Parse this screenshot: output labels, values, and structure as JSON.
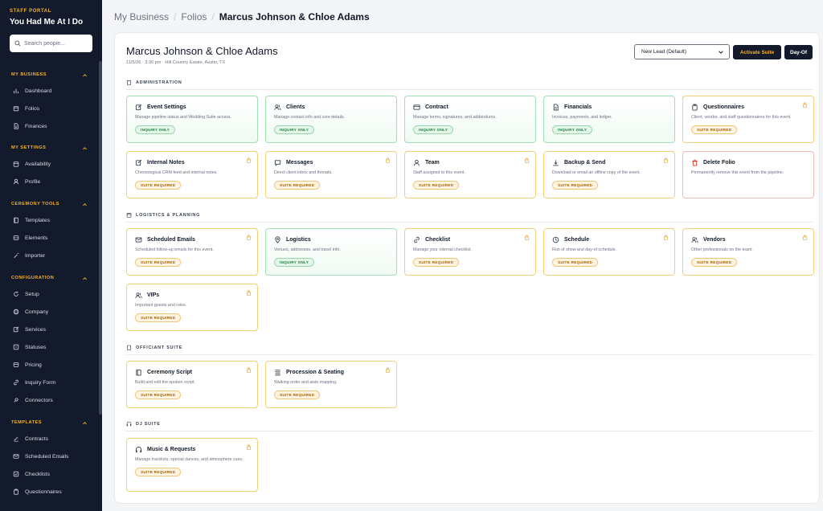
{
  "sidebar": {
    "kicker": "STAFF PORTAL",
    "title": "You Had Me At I Do",
    "search_placeholder": "Search people...",
    "sections": [
      {
        "label": "MY BUSINESS",
        "items": [
          {
            "label": "Dashboard",
            "icon": "bar-chart-icon"
          },
          {
            "label": "Folios",
            "icon": "folder-icon"
          },
          {
            "label": "Finances",
            "icon": "document-icon"
          }
        ]
      },
      {
        "label": "MY SETTINGS",
        "items": [
          {
            "label": "Availability",
            "icon": "calendar-icon"
          },
          {
            "label": "Profile",
            "icon": "user-icon"
          }
        ]
      },
      {
        "label": "CEREMONY TOOLS",
        "items": [
          {
            "label": "Templates",
            "icon": "book-icon"
          },
          {
            "label": "Elements",
            "icon": "layers-icon"
          },
          {
            "label": "Importer",
            "icon": "wand-icon"
          }
        ]
      },
      {
        "label": "CONFIGURATION",
        "items": [
          {
            "label": "Setup",
            "icon": "refresh-icon"
          },
          {
            "label": "Company",
            "icon": "globe-icon"
          },
          {
            "label": "Services",
            "icon": "edit-icon"
          },
          {
            "label": "Statuses",
            "icon": "list-icon"
          },
          {
            "label": "Pricing",
            "icon": "tag-icon"
          },
          {
            "label": "Inquiry Form",
            "icon": "link-icon"
          },
          {
            "label": "Connectors",
            "icon": "plug-icon"
          }
        ]
      },
      {
        "label": "TEMPLATES",
        "items": [
          {
            "label": "Contracts",
            "icon": "pen-icon"
          },
          {
            "label": "Scheduled Emails",
            "icon": "mail-icon"
          },
          {
            "label": "Checklists",
            "icon": "check-square-icon"
          },
          {
            "label": "Questionnaires",
            "icon": "clipboard-icon"
          }
        ]
      }
    ]
  },
  "breadcrumb": {
    "items": [
      "My Business",
      "Folios"
    ],
    "current": "Marcus Johnson & Chloe Adams"
  },
  "folio": {
    "title": "Marcus Johnson & Chloe Adams",
    "subtitle": "11/5/26 · 3:30 pm · Hill Country Estate, Austin, TX",
    "status_selected": "New Lead (Default)",
    "activate_label": "Activate Suite",
    "dayof_label": "Day-Of"
  },
  "badges": {
    "suite": "SUITE REQUIRED",
    "inquiry": "INQUIRY ONLY"
  },
  "colors": {
    "sidebar_bg": "#131a2b",
    "accent": "#f2b233",
    "inquiry_green": "#1b7a3e",
    "suite_amber": "#a35d00",
    "danger": "#d92d20"
  },
  "sections": {
    "administration": {
      "label": "ADMINISTRATION",
      "cards": [
        {
          "title": "Event Settings",
          "desc": "Manage pipeline status and Wedding Suite access.",
          "badge": "inquiry",
          "lock": false,
          "icon": "edit-icon"
        },
        {
          "title": "Clients",
          "desc": "Manage contact info and core details.",
          "badge": "inquiry",
          "lock": false,
          "icon": "users-icon"
        },
        {
          "title": "Contract",
          "desc": "Manage terms, signatures, and addendums.",
          "badge": "inquiry",
          "lock": false,
          "icon": "contract-icon"
        },
        {
          "title": "Financials",
          "desc": "Invoices, payments, and ledger.",
          "badge": "inquiry",
          "lock": false,
          "icon": "document-icon"
        },
        {
          "title": "Questionnaires",
          "desc": "Client, vendor, and staff questionnaires for this event.",
          "badge": "suite",
          "lock": true,
          "icon": "clipboard-icon"
        },
        {
          "title": "Internal Notes",
          "desc": "Chronological CRM feed and internal notes.",
          "badge": "suite",
          "lock": true,
          "icon": "edit-icon"
        },
        {
          "title": "Messages",
          "desc": "Direct client inbox and threads.",
          "badge": "suite",
          "lock": true,
          "icon": "message-icon"
        },
        {
          "title": "Team",
          "desc": "Staff assigned to this event.",
          "badge": "suite",
          "lock": true,
          "icon": "user-icon"
        },
        {
          "title": "Backup & Send",
          "desc": "Download or email an offline copy of the event.",
          "badge": "suite",
          "lock": true,
          "icon": "download-icon"
        },
        {
          "title": "Delete Folio",
          "desc": "Permanently remove this event from the pipeline.",
          "badge": "none",
          "lock": false,
          "icon": "trash-icon"
        }
      ]
    },
    "logistics": {
      "label": "LOGISTICS & PLANNING",
      "cards": [
        {
          "title": "Scheduled Emails",
          "desc": "Scheduled follow-up emails for this event.",
          "badge": "suite",
          "lock": true,
          "icon": "mail-icon"
        },
        {
          "title": "Logistics",
          "desc": "Venues, addresses, and travel info.",
          "badge": "inquiry",
          "lock": false,
          "icon": "map-pin-icon"
        },
        {
          "title": "Checklist",
          "desc": "Manage your internal checklist.",
          "badge": "suite",
          "lock": true,
          "icon": "link-icon"
        },
        {
          "title": "Schedule",
          "desc": "Run of show and day-of schedule.",
          "badge": "suite",
          "lock": true,
          "icon": "clock-icon"
        },
        {
          "title": "Vendors",
          "desc": "Other professionals on the team.",
          "badge": "suite",
          "lock": true,
          "icon": "users-icon"
        },
        {
          "title": "VIPs",
          "desc": "Important guests and roles.",
          "badge": "suite",
          "lock": true,
          "icon": "users-icon"
        }
      ]
    },
    "officiant": {
      "label": "OFFICIANT SUITE",
      "cards": [
        {
          "title": "Ceremony Script",
          "desc": "Build and edit the spoken script.",
          "badge": "suite",
          "lock": true,
          "icon": "book-icon"
        },
        {
          "title": "Procession & Seating",
          "desc": "Walking order and aisle mapping.",
          "badge": "suite",
          "lock": true,
          "icon": "seating-icon"
        }
      ]
    },
    "dj": {
      "label": "DJ SUITE",
      "cards": [
        {
          "title": "Music & Requests",
          "desc": "Manage tracklists, special dances, and atmosphere cues.",
          "badge": "suite",
          "lock": true,
          "icon": "headphones-icon"
        }
      ]
    }
  }
}
